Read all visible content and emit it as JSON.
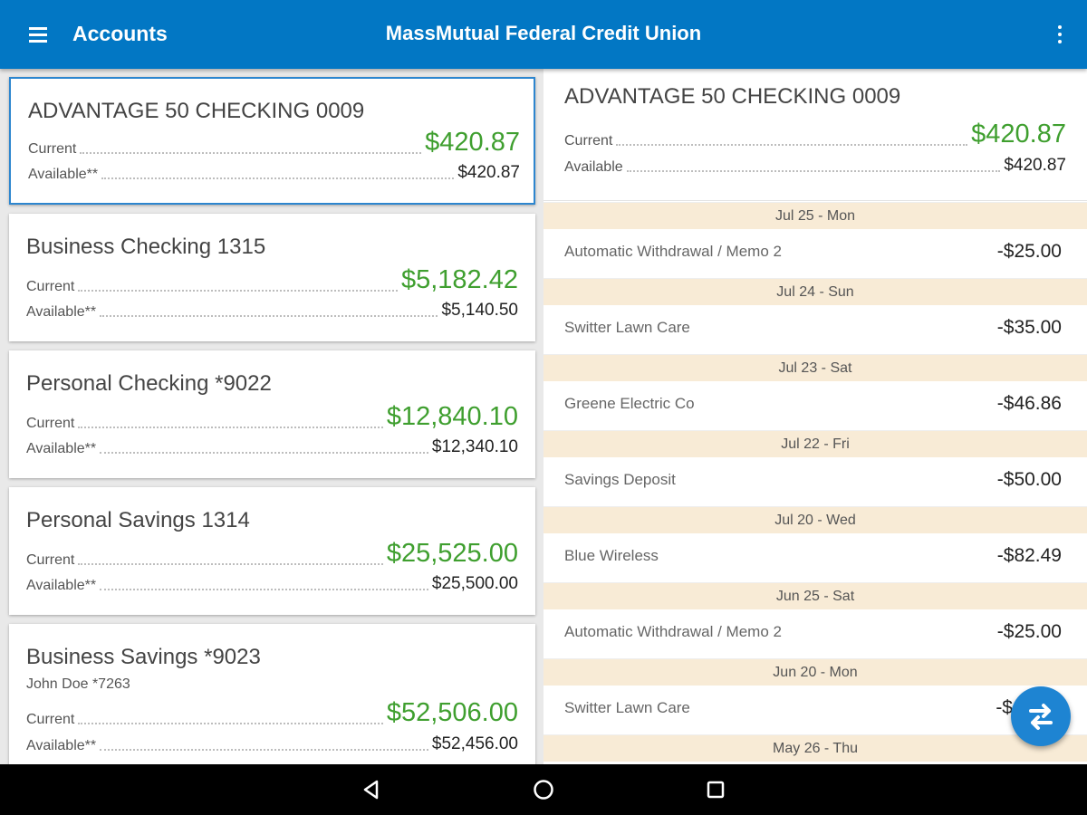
{
  "appbar": {
    "title": "Accounts",
    "center_title": "MassMutual Federal Credit Union",
    "color": "#0277c4"
  },
  "accounts": [
    {
      "name": "ADVANTAGE 50 CHECKING 0009",
      "sub": "",
      "current_label": "Current",
      "current": "$420.87",
      "available_label": "Available**",
      "available": "$420.87",
      "selected": true
    },
    {
      "name": "Business Checking 1315",
      "sub": "",
      "current_label": "Current",
      "current": "$5,182.42",
      "available_label": "Available**",
      "available": "$5,140.50",
      "selected": false
    },
    {
      "name": "Personal Checking *9022",
      "sub": "",
      "current_label": "Current",
      "current": "$12,840.10",
      "available_label": "Available**",
      "available": "$12,340.10",
      "selected": false
    },
    {
      "name": "Personal Savings 1314",
      "sub": "",
      "current_label": "Current",
      "current": "$25,525.00",
      "available_label": "Available**",
      "available": "$25,500.00",
      "selected": false
    },
    {
      "name": "Business Savings *9023",
      "sub": "John Doe *7263",
      "current_label": "Current",
      "current": "$52,506.00",
      "available_label": "Available**",
      "available": "$52,456.00",
      "selected": false
    }
  ],
  "detail": {
    "name": "ADVANTAGE 50 CHECKING 0009",
    "current_label": "Current",
    "current": "$420.87",
    "available_label": "Available",
    "available": "$420.87"
  },
  "transactions": [
    {
      "date": "Jul 25 - Mon",
      "desc": "Automatic Withdrawal / Memo 2",
      "amount": "-$25.00"
    },
    {
      "date": "Jul 24 - Sun",
      "desc": "Switter Lawn Care",
      "amount": "-$35.00"
    },
    {
      "date": "Jul 23 - Sat",
      "desc": "Greene Electric Co",
      "amount": "-$46.86"
    },
    {
      "date": "Jul 22 - Fri",
      "desc": "Savings Deposit",
      "amount": "-$50.00"
    },
    {
      "date": "Jul 20 - Wed",
      "desc": "Blue Wireless",
      "amount": "-$82.49"
    },
    {
      "date": "Jun 25 - Sat",
      "desc": "Automatic Withdrawal / Memo 2",
      "amount": "-$25.00"
    },
    {
      "date": "Jun 20 - Mon",
      "desc": "Switter Lawn Care",
      "amount": "-$"
    },
    {
      "date": "May 26 - Thu",
      "desc": "",
      "amount": ""
    }
  ],
  "fab": {
    "icon": "transfer-arrows-icon"
  },
  "navbar": {
    "back_icon": "back-triangle-icon",
    "home_icon": "home-circle-icon",
    "recents_icon": "recents-square-icon"
  },
  "colors": {
    "positive_amount": "#3f9f2f",
    "date_header_bg": "#f8ebd6",
    "fab": "#1e84d2"
  }
}
